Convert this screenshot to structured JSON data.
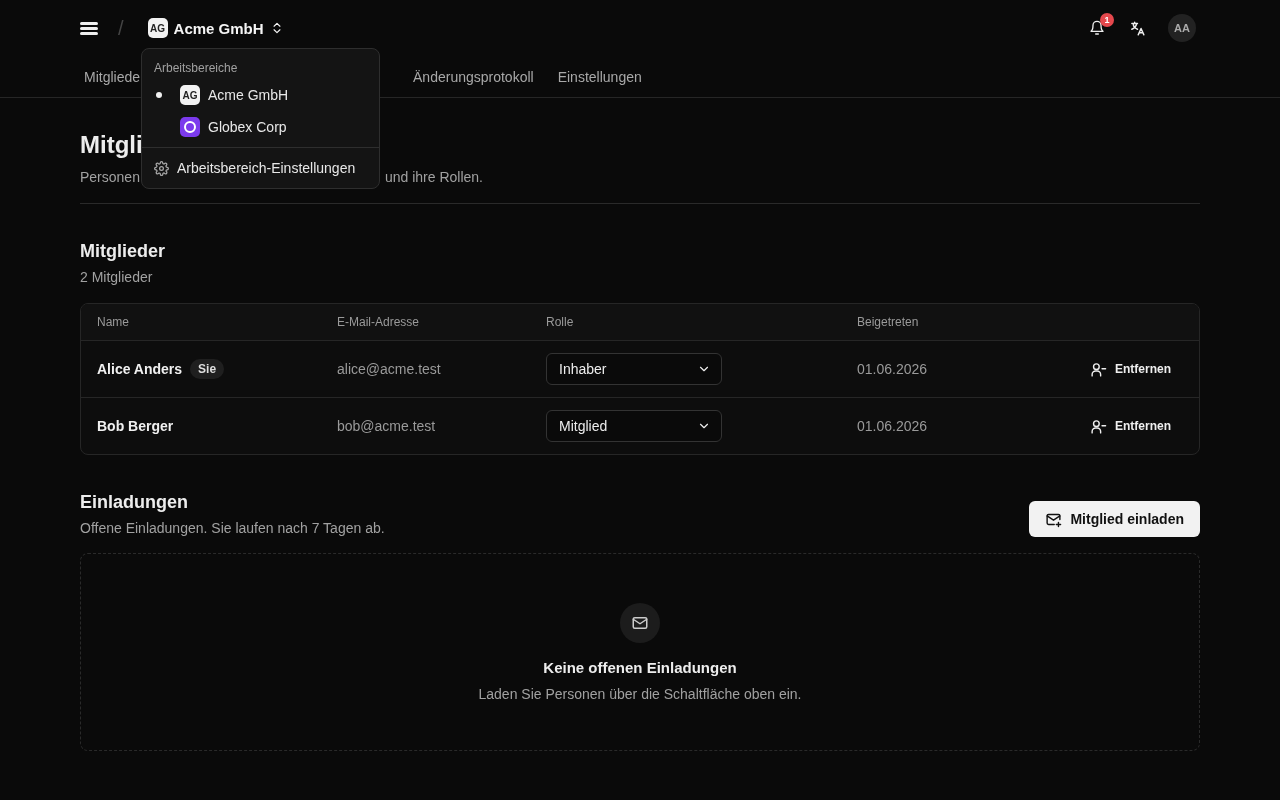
{
  "header": {
    "separator": "/",
    "workspace": {
      "initials": "AG",
      "name": "Acme GmbH"
    },
    "notifications": {
      "count": "1"
    },
    "user": {
      "initials": "AA"
    }
  },
  "workspace_menu": {
    "heading": "Arbeitsbereiche",
    "items": [
      {
        "kind": "initials",
        "initials": "AG",
        "name": "Acme GmbH",
        "selected": true,
        "color": "#f2f2f2"
      },
      {
        "kind": "logo",
        "name": "Globex Corp",
        "selected": false,
        "color": "#7c3aed"
      }
    ],
    "settings": "Arbeitsbereich-Einstellungen"
  },
  "tabs": [
    {
      "label": "Mitgliede"
    },
    {
      "label": "Änderungsprotokoll"
    },
    {
      "label": "Einstellungen"
    }
  ],
  "page": {
    "title": "Mitgli",
    "description": [
      "Personen",
      "und ihre Rollen."
    ]
  },
  "members": {
    "title": "Mitglieder",
    "count": "2 Mitglieder",
    "columns": [
      "Name",
      "E-Mail-Adresse",
      "Rolle",
      "Beigetreten"
    ],
    "rows": [
      {
        "name": "Alice Anders",
        "badge": "Sie",
        "email": "alice@acme.test",
        "role": "Inhaber",
        "joined": "01.06.2026",
        "action": "Entfernen"
      },
      {
        "name": "Bob Berger",
        "email": "bob@acme.test",
        "role": "Mitglied",
        "joined": "01.06.2026",
        "action": "Entfernen"
      }
    ]
  },
  "invitations": {
    "title": "Einladungen",
    "description": "Offene Einladungen. Sie laufen nach 7 Tagen ab.",
    "button": "Mitglied einladen",
    "empty": {
      "title": "Keine offenen Einladungen",
      "text": "Laden Sie Personen über die Schaltfläche oben ein."
    }
  }
}
